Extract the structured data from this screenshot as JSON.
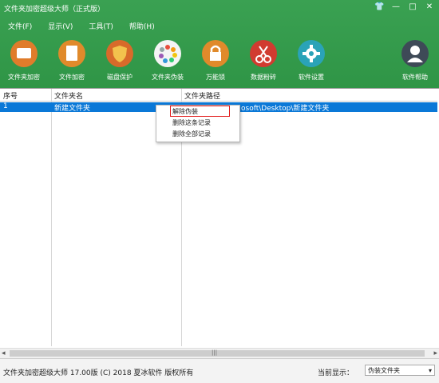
{
  "window": {
    "title": "文件夹加密超级大师（正式版）",
    "controls": [
      "👕",
      "—",
      "□",
      "✕"
    ]
  },
  "menu": [
    "文件(F)",
    "显示(V)",
    "工具(T)",
    "帮助(H)"
  ],
  "toolbar": [
    {
      "label": "文件夹加密",
      "icon": "folder-icon",
      "color": "#e07c2b"
    },
    {
      "label": "文件加密",
      "icon": "clipboard-icon",
      "color": "#e08a2b"
    },
    {
      "label": "磁盘保护",
      "icon": "shield-icon",
      "color": "#d86a2a"
    },
    {
      "label": "文件夹伪装",
      "icon": "palette-icon",
      "color": "#f4f4f4"
    },
    {
      "label": "万能锁",
      "icon": "lock-icon",
      "color": "#e08a2b"
    },
    {
      "label": "数据粉碎",
      "icon": "scissors-icon",
      "color": "#d13b30"
    },
    {
      "label": "软件设置",
      "icon": "gear-icon",
      "color": "#2aa3b8"
    },
    {
      "label": "软件帮助",
      "icon": "user-help-icon",
      "color": "#3e4a57"
    }
  ],
  "table": {
    "headers": [
      "序号",
      "文件夹名",
      "文件夹路径"
    ],
    "rows": [
      {
        "index": "1",
        "name": "新建文件夹",
        "path": "osoft\\Desktop\\新建文件夹"
      }
    ]
  },
  "context_menu": [
    "解除伪装",
    "删除这条记录",
    "删除全部记录"
  ],
  "status": {
    "info": "文件夹加密超级大师 17.00版 (C) 2018 夏冰软件 版权所有",
    "display_label": "当前显示：",
    "display_value": "伪装文件夹"
  }
}
